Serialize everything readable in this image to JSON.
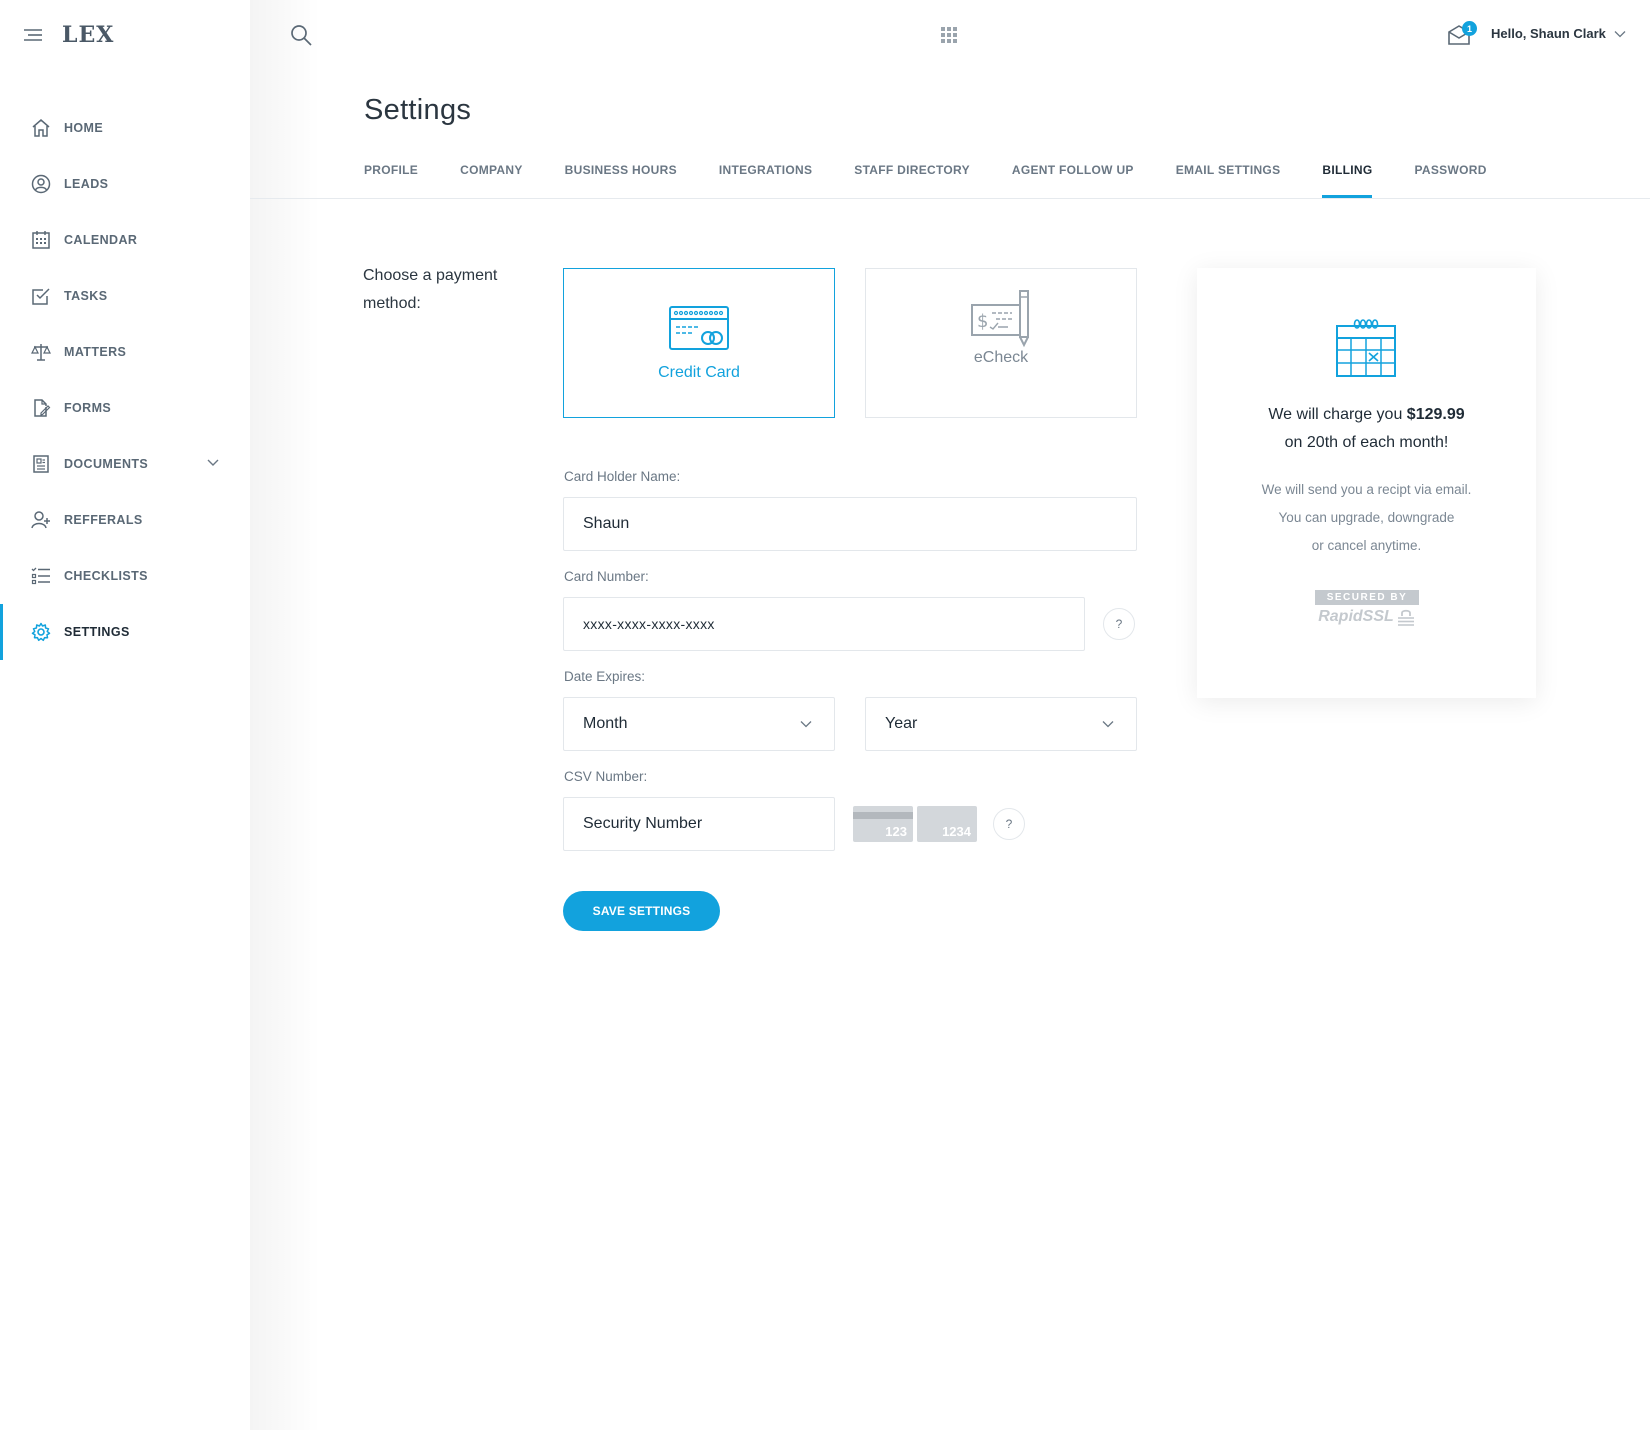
{
  "app": {
    "logo": "LEX",
    "greeting": "Hello, Shaun Clark",
    "notification_count": "1"
  },
  "sidebar": {
    "items": [
      {
        "label": "HOME",
        "icon": "home-icon"
      },
      {
        "label": "LEADS",
        "icon": "user-circle-icon"
      },
      {
        "label": "CALENDAR",
        "icon": "calendar-icon"
      },
      {
        "label": "TASKS",
        "icon": "checkbox-icon"
      },
      {
        "label": "MATTERS",
        "icon": "scales-icon"
      },
      {
        "label": "FORMS",
        "icon": "form-edit-icon"
      },
      {
        "label": "DOCUMENTS",
        "icon": "document-icon"
      },
      {
        "label": "REFFERALS",
        "icon": "user-plus-icon"
      },
      {
        "label": "CHECKLISTS",
        "icon": "checklist-icon"
      },
      {
        "label": "SETTINGS",
        "icon": "gear-icon"
      }
    ],
    "active": "SETTINGS"
  },
  "page": {
    "title": "Settings",
    "tabs": [
      {
        "label": "PROFILE"
      },
      {
        "label": "COMPANY"
      },
      {
        "label": "BUSINESS HOURS"
      },
      {
        "label": "INTEGRATIONS"
      },
      {
        "label": "STAFF DIRECTORY"
      },
      {
        "label": "AGENT FOLLOW UP"
      },
      {
        "label": "EMAIL SETTINGS"
      },
      {
        "label": "BILLING"
      },
      {
        "label": "PASSWORD"
      }
    ],
    "active_tab": "BILLING"
  },
  "payment": {
    "choose_label": "Choose a payment method:",
    "methods": [
      {
        "label": "Credit Card",
        "icon": "credit-card-icon",
        "selected": true
      },
      {
        "label": "eCheck",
        "icon": "check-icon",
        "selected": false
      }
    ]
  },
  "form": {
    "holder_label": "Card Holder Name:",
    "holder_value": "Shaun",
    "number_label": "Card Number:",
    "number_value": "xxxx-xxxx-xxxx-xxxx",
    "help_symbol": "?",
    "expires_label": "Date Expires:",
    "month_value": "Month",
    "year_value": "Year",
    "csv_label": "CSV Number:",
    "csv_placeholder": "Security Number",
    "csv_card_3": "123",
    "csv_card_4": "1234",
    "save_label": "SAVE SETTINGS"
  },
  "summary": {
    "charge_prefix": "We will charge you ",
    "charge_amount": "$129.99",
    "charge_suffix": "on 20th of each month!",
    "note_line1": "We will send you a recipt via email.",
    "note_line2": "You can upgrade, downgrade",
    "note_line3": "or cancel anytime.",
    "ssl_top": "SECURED BY",
    "ssl_bottom": "RapidSSL"
  },
  "colors": {
    "accent": "#12a2dd",
    "text_dark": "#1f2b36",
    "text_muted": "#6a7784",
    "border": "#e3e7eb"
  }
}
